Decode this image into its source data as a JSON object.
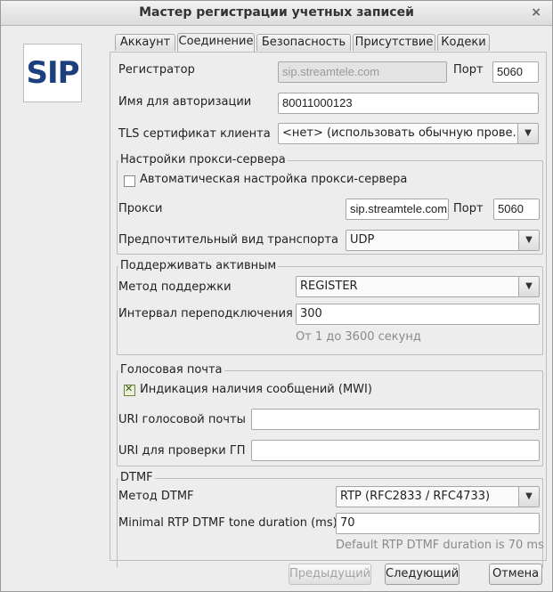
{
  "window": {
    "title": "Мастер регистрации учетных записей",
    "close_glyph": "×"
  },
  "logo": {
    "text": "SIP"
  },
  "tabs": [
    {
      "label": "Аккаунт"
    },
    {
      "label": "Соединение"
    },
    {
      "label": "Безопасность"
    },
    {
      "label": "Присутствие"
    },
    {
      "label": "Кодеки"
    }
  ],
  "connection": {
    "registrar_label": "Регистратор",
    "registrar_value": "sip.streamtele.com",
    "port_label": "Порт",
    "registrar_port": "5060",
    "auth_name_label": "Имя для авторизации",
    "auth_name_value": "80011000123",
    "tls_label": "TLS сертификат клиента",
    "tls_value": "<нет> (использовать обычную прове..."
  },
  "proxy": {
    "group_title": "Настройки прокси-сервера",
    "auto_label": "Автоматическая настройка прокси-сервера",
    "auto_checked": false,
    "proxy_label": "Прокси",
    "proxy_value": "sip.streamtele.com",
    "port_label": "Порт",
    "port_value": "5060",
    "transport_label": "Предпочтительный вид транспорта",
    "transport_value": "UDP"
  },
  "keepalive": {
    "group_title": "Поддерживать активным",
    "method_label": "Метод поддержки",
    "method_value": "REGISTER",
    "interval_label": "Интервал переподключения",
    "interval_value": "300",
    "interval_hint": "От 1 до 3600 секунд"
  },
  "voicemail": {
    "group_title": "Голосовая почта",
    "mwi_label": "Индикация наличия сообщений (MWI)",
    "mwi_checked": true,
    "uri_label": "URI голосовой почты",
    "uri_value": "",
    "check_uri_label": "URI для проверки ГП",
    "check_uri_value": ""
  },
  "dtmf": {
    "group_title": "DTMF",
    "method_label": "Метод DTMF",
    "method_value": "RTP (RFC2833 / RFC4733)",
    "min_duration_label": "Minimal RTP DTMF tone duration (ms)",
    "min_duration_value": "70",
    "duration_hint": "Default RTP DTMF duration is 70 ms"
  },
  "footer": {
    "prev_label": "Предыдущий",
    "next_label": "Следующий",
    "cancel_label": "Отмена"
  },
  "icons": {
    "dropdown": "chevron-down-icon",
    "check": "checkmark-icon",
    "close": "close-icon"
  }
}
